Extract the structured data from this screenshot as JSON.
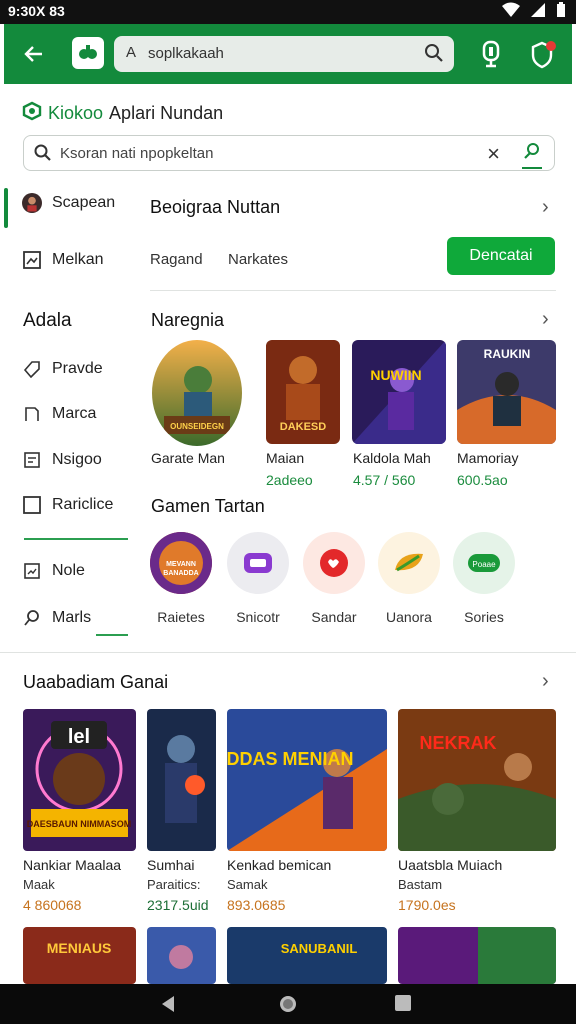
{
  "status": {
    "time": "9:30X 83"
  },
  "appbar": {
    "search_prefix": "A",
    "search_query": "soplkakaah"
  },
  "header": {
    "brand": "Kiokoo",
    "title": "Aplari Nundan"
  },
  "search": {
    "placeholder": "Ksoran nati npopkeltan"
  },
  "rail": {
    "top_items": [
      {
        "label": "Scapean"
      },
      {
        "label": "Melkan"
      }
    ],
    "section_title": "Adala",
    "items": [
      {
        "label": "Pravde"
      },
      {
        "label": "Marca"
      },
      {
        "label": "Nsigoo"
      },
      {
        "label": "Rariclice"
      },
      {
        "label": "Nole"
      },
      {
        "label": "Marls"
      }
    ]
  },
  "featured": {
    "title": "Beoigraa Nuttan",
    "chips": [
      "Ragand",
      "Narkates"
    ],
    "button": "Dencatai"
  },
  "section1": {
    "title": "Naregnia",
    "games": [
      {
        "name": "Garate Man",
        "price": ""
      },
      {
        "name": "Maian",
        "price": "2adeeo"
      },
      {
        "name": "Kaldola Mah",
        "price": "4.57 / 560"
      },
      {
        "name": "Mamoriay",
        "price": "600.5ao"
      }
    ],
    "art_text": [
      "OUNSEIDEGN",
      "DAKESD",
      "NUWIIN",
      "RAUKIN"
    ]
  },
  "section2": {
    "title": "Gamen Tartan",
    "circles": [
      {
        "label": "Raietes",
        "icon": "game-badge-icon"
      },
      {
        "label": "Snicotr",
        "icon": "controller-icon"
      },
      {
        "label": "Sandar",
        "icon": "chat-heart-icon"
      },
      {
        "label": "Uanora",
        "icon": "leaf-icon"
      },
      {
        "label": "Sories",
        "icon": "play-badge-icon"
      }
    ],
    "circle_badge": {
      "line1": "MEVANN",
      "line2": "BANADDA"
    },
    "badge_text": "Poaae"
  },
  "section3": {
    "title": "Uaabadiam Ganai",
    "games": [
      {
        "name": "Nankiar Maalaa",
        "sub": "Maak",
        "price": "4 860068"
      },
      {
        "name": "Sumhai",
        "sub": "Paraitics:",
        "price": "2317.5uid"
      },
      {
        "name": "Kenkad bemican",
        "sub": "Samak",
        "price": "893.0685"
      },
      {
        "name": "Uaatsbla Muiach",
        "sub": "Bastam",
        "price": "1790.0es"
      }
    ],
    "art_text": [
      "lel",
      "DAESBAUN NIMMASOM",
      "DADDAS MENIAN",
      "NEKRAK"
    ],
    "more_art_text": [
      "MENIAUS",
      "SANUBANIL"
    ]
  },
  "colors": {
    "primary": "#138a3c",
    "button": "#0fa93a",
    "price_green": "#1b8c3e",
    "price_orange": "#c6731e"
  }
}
